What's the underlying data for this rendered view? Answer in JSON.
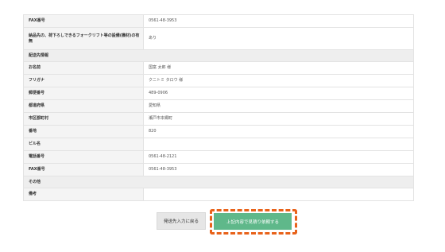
{
  "rows_top": [
    {
      "label": "FAX番号",
      "value": "0561-48-3953"
    },
    {
      "label": "納品先の、荷下ろしできるフォークリフト等の設備(機材)の有無",
      "value": "あり"
    }
  ],
  "section_delivery": "配送先情報",
  "rows_delivery": [
    {
      "label": "お名前",
      "value": "国富 太郎 様"
    },
    {
      "label": "フリガナ",
      "value": "クニトミ タロウ 様"
    },
    {
      "label": "郵便番号",
      "value": "489-0906"
    },
    {
      "label": "都道府県",
      "value": "愛知県"
    },
    {
      "label": "市区郡町村",
      "value": "瀬戸市本郷町"
    },
    {
      "label": "番地",
      "value": "820"
    },
    {
      "label": "ビル名",
      "value": ""
    },
    {
      "label": "電話番号",
      "value": "0561-48-2121"
    },
    {
      "label": "FAX番号",
      "value": "0561-48-3953"
    }
  ],
  "section_other": "その他",
  "rows_other": [
    {
      "label": "備考",
      "value": ""
    }
  ],
  "buttons": {
    "back_label": "発送先入力に戻る",
    "submit_label": "上記内容で見積り依頼する"
  }
}
